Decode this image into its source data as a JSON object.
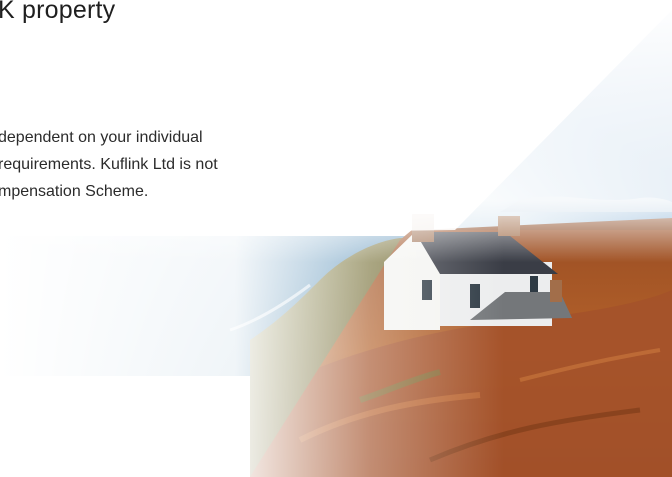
{
  "hero": {
    "heading": "K property",
    "body_lines": [
      "dependent on your individual",
      "requirements. Kuflink Ltd is not",
      "mpensation Scheme."
    ],
    "image_alt": "White cottage on a cliff top above the sea",
    "colors": {
      "text": "#1f1f1f",
      "sky": "#3c78b8",
      "sea": "#4a8ab8",
      "bracken": "#b05a24",
      "roof": "#3a3d44",
      "wall": "#f3f3f0"
    }
  }
}
